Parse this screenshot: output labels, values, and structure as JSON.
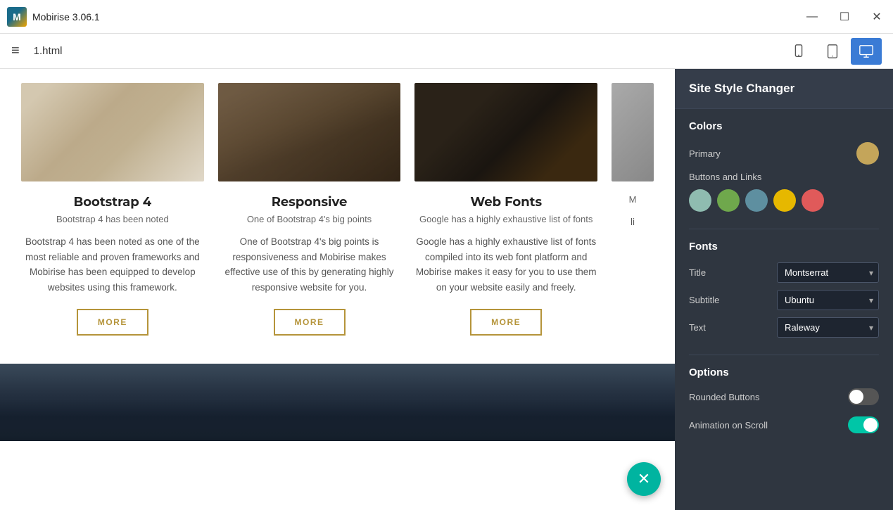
{
  "app": {
    "title": "Mobirise 3.06.1",
    "logo_letter": "M"
  },
  "titlebar": {
    "minimize": "—",
    "maximize": "☐",
    "close": "✕"
  },
  "toolbar": {
    "hamburger": "≡",
    "file_name": "1.html"
  },
  "devices": [
    {
      "id": "mobile",
      "label": "Mobile"
    },
    {
      "id": "tablet",
      "label": "Tablet"
    },
    {
      "id": "desktop",
      "label": "Desktop",
      "active": true
    }
  ],
  "cards": [
    {
      "id": "bootstrap",
      "title": "Bootstrap 4",
      "subtitle": "Bootstrap 4 has been noted",
      "body": "Bootstrap 4 has been noted as one of the most reliable and proven frameworks and Mobirise has been equipped to develop websites using this framework.",
      "btn_label": "MORE",
      "img_class": "img-desk"
    },
    {
      "id": "responsive",
      "title": "Responsive",
      "subtitle": "One of Bootstrap 4's big points",
      "body": "One of Bootstrap 4's big points is responsiveness and Mobirise makes effective use of this by generating highly responsive website for you.",
      "btn_label": "MORE",
      "img_class": "img-laptop"
    },
    {
      "id": "webfonts",
      "title": "Web Fonts",
      "subtitle": "Google has a highly exhaustive list of fonts",
      "body": "Google has a highly exhaustive list of fonts compiled into its web font platform and Mobirise makes it easy for you to use them on your website easily and freely.",
      "btn_label": "MORE",
      "img_class": "img-work"
    },
    {
      "id": "partial",
      "title": "",
      "subtitle": "M",
      "body": "li",
      "btn_label": "",
      "img_class": "img-partial"
    }
  ],
  "panel": {
    "title": "Site Style Changer",
    "colors_section": "Colors",
    "primary_label": "Primary",
    "primary_color": "#c4a55a",
    "buttons_links_label": "Buttons and Links",
    "color_swatches": [
      {
        "color": "#8fbcb0",
        "id": "swatch-1"
      },
      {
        "color": "#6fa84c",
        "id": "swatch-2"
      },
      {
        "color": "#5e8fa0",
        "id": "swatch-3"
      },
      {
        "color": "#e6b800",
        "id": "swatch-4"
      },
      {
        "color": "#e05a5a",
        "id": "swatch-5"
      }
    ],
    "fonts_section": "Fonts",
    "font_labels": [
      "Title",
      "Subtitle",
      "Text"
    ],
    "font_values": [
      "Montserrat",
      "Ubuntu",
      "Raleway"
    ],
    "options_section": "Options",
    "options": [
      {
        "label": "Rounded Buttons",
        "state": "off"
      },
      {
        "label": "Animation on Scroll",
        "state": "on"
      }
    ]
  },
  "fab": {
    "icon": "✕"
  }
}
